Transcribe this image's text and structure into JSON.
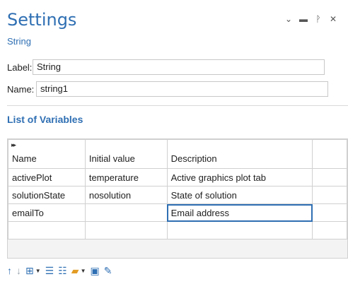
{
  "header": {
    "title": "Settings",
    "subtitle": "String"
  },
  "window_controls": {
    "collapse_icon": "chevron-down-icon",
    "maximize_icon": "maximize-icon",
    "pin_icon": "pin-icon",
    "close_icon": "close-icon"
  },
  "fields": {
    "label": {
      "label": "Label:",
      "value": "String"
    },
    "name": {
      "label": "Name:",
      "value": "string1"
    }
  },
  "section": {
    "title": "List of Variables"
  },
  "table": {
    "expand_glyph": "▸▸",
    "columns": [
      "Name",
      "Initial value",
      "Description"
    ],
    "rows": [
      {
        "name": "activePlot",
        "initial_value": "temperature",
        "description": "Active graphics plot tab"
      },
      {
        "name": "solutionState",
        "initial_value": "nosolution",
        "description": "State of solution"
      },
      {
        "name": "emailTo",
        "initial_value": "",
        "description": "Email address"
      },
      {
        "name": "",
        "initial_value": "",
        "description": ""
      }
    ]
  },
  "toolbar": {
    "icons": [
      "move-up-icon",
      "move-down-icon",
      "insert-icon",
      "add-row-icon",
      "clear-table-icon",
      "open-folder-icon",
      "save-icon",
      "edit-icon"
    ]
  },
  "colors": {
    "accent": "#2f6fb3",
    "border": "#d0d0d0",
    "folder": "#e39c24"
  }
}
